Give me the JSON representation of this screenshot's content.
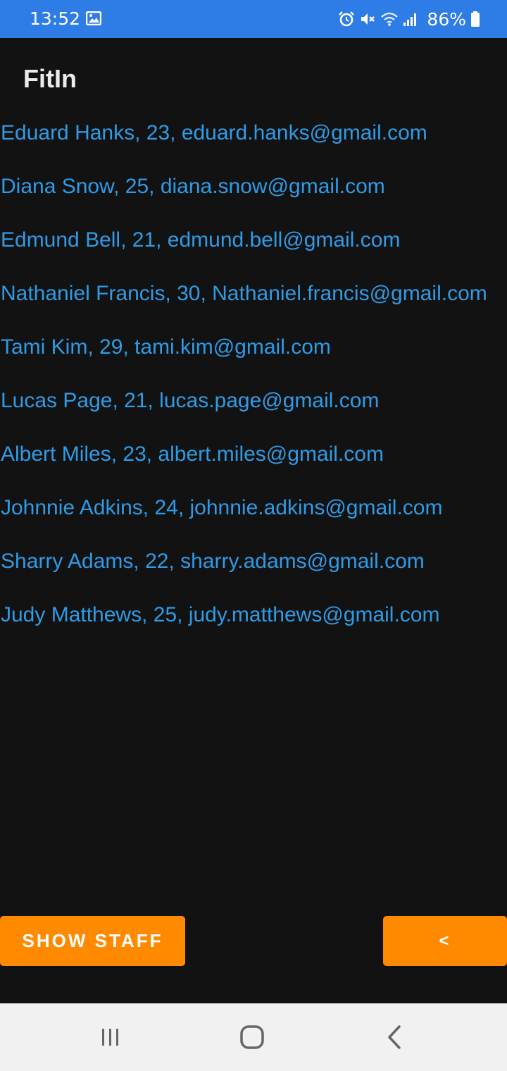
{
  "status_bar": {
    "time": "13:52",
    "battery": "86%",
    "icons": [
      "gallery-icon",
      "alarm-icon",
      "mute-icon",
      "wifi-icon",
      "signal-icon",
      "battery-icon"
    ]
  },
  "app": {
    "title": "FitIn"
  },
  "members": [
    "Eduard Hanks, 23, eduard.hanks@gmail.com",
    "Diana Snow, 25, diana.snow@gmail.com",
    "Edmund Bell, 21, edmund.bell@gmail.com",
    "Nathaniel Francis, 30, Nathaniel.francis@gmail.com",
    "Tami Kim, 29, tami.kim@gmail.com",
    "Lucas Page, 21, lucas.page@gmail.com",
    "Albert Miles, 23, albert.miles@gmail.com",
    "Johnnie Adkins, 24, johnnie.adkins@gmail.com",
    "Sharry Adams, 22, sharry.adams@gmail.com",
    "Judy Matthews, 25, judy.matthews@gmail.com"
  ],
  "buttons": {
    "show_staff": "SHOW STAFF",
    "back": "<"
  },
  "nav": {
    "icons": [
      "recent-apps-icon",
      "home-icon",
      "back-icon"
    ]
  },
  "colors": {
    "status_bar": "#2e7de6",
    "background": "#121212",
    "list_text": "#2f9be6",
    "accent_button": "#ff8a00",
    "nav_bar": "#f1f1f1"
  }
}
